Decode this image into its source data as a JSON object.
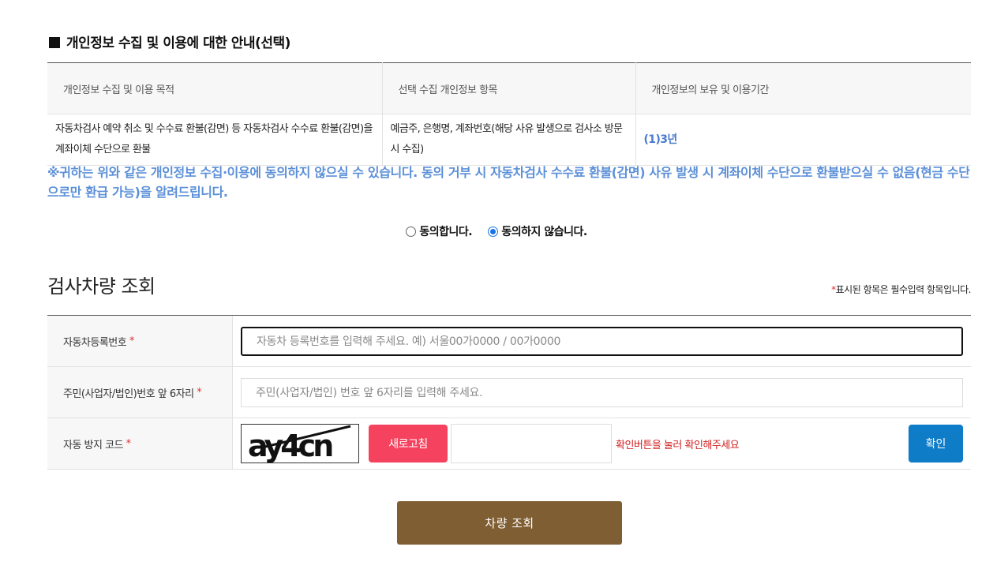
{
  "privacy": {
    "title": "개인정보 수집 및 이용에 대한 안내(선택)",
    "headers": [
      "개인정보 수집 및 이용 목적",
      "선택 수집 개인정보 항목",
      "개인정보의 보유 및 이용기간"
    ],
    "row": {
      "purpose": "자동차검사 예약 취소 및 수수료 환불(감면) 등 자동차검사 수수료 환불(감면)을 계좌이체 수단으로 환불",
      "items": "예금주, 은행명, 계좌번호(해당 사유 발생으로 검사소 방문 시 수집)",
      "period": "(1)3년"
    },
    "notice": "※귀하는 위와 같은 개인정보 수집·이용에 동의하지 않으실 수 있습니다. 동의 거부 시 자동차검사 수수료 환불(감면) 사유 발생 시 계좌이체 수단으로 환불받으실 수 없음(현금 수단으로만 환급 가능)을 알려드립니다.",
    "agree_label": "동의합니다.",
    "disagree_label": "동의하지 않습니다.",
    "selected": "disagree"
  },
  "lookup": {
    "title": "검사차량 조회",
    "required_note": "표시된 항목은 필수입력 항목입니다.",
    "required_mark": "*",
    "fields": {
      "reg_no": {
        "label": "자동차등록번호",
        "placeholder": "자동차 등록번호를 입력해 주세요. 예) 서울00가0000 / 00가0000"
      },
      "id_prefix": {
        "label": "주민(사업자/법인)번호 앞 6자리",
        "placeholder": "주민(사업자/법인) 번호 앞 6자리를 입력해 주세요."
      },
      "captcha": {
        "label": "자동 방지 코드",
        "image_text": "ay4cn",
        "refresh_label": "새로고침",
        "message": "확인버튼을 눌러 확인해주세요",
        "confirm_label": "확인"
      }
    },
    "submit_label": "차량 조회"
  },
  "colors": {
    "notice": "#5b8fd8",
    "refresh_button": "#f5425f",
    "confirm_button": "#0f7cc7",
    "submit_button": "#7f5e33",
    "required": "#e03030"
  }
}
